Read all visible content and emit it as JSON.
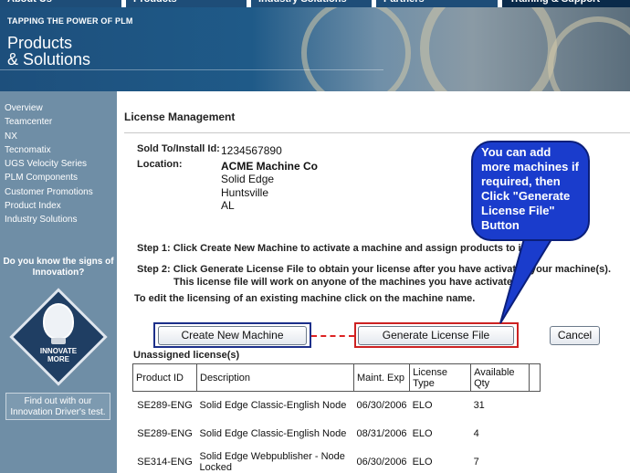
{
  "top_nav": [
    "About Us",
    "Products",
    "Industry Solutions",
    "Partners",
    "Training & Support"
  ],
  "banner": {
    "tagline": "TAPPING THE POWER OF PLM",
    "title_line1": "Products",
    "title_line2": "& Solutions"
  },
  "sidebar": {
    "items": [
      "Overview",
      "Teamcenter",
      "NX",
      "Tecnomatix",
      "UGS Velocity Series",
      "PLM Components",
      "Customer Promotions",
      "Product Index",
      "Industry Solutions"
    ],
    "promo_question": "Do you know the signs of Innovation?",
    "promo_badge_line1": "INNOVATE",
    "promo_badge_line2": "MORE",
    "promo_button": "Find out with our Innovation Driver's test."
  },
  "main": {
    "title": "License Management",
    "sold_to_label": "Sold To/Install Id:",
    "sold_to_value": "1234567890",
    "location_label": "Location:",
    "location_company": "ACME Machine Co",
    "location_line2": "Solid Edge",
    "location_line3": "Huntsville",
    "location_line4": "AL",
    "step1": "Step 1: Click Create New Machine to activate a machine and assign products to it.",
    "step2_line1": "Step 2: Click Generate License File to obtain your license after you have activated your machine(s).",
    "step2_line2": "This license file will work on anyone of the machines you have activated.",
    "edit_note": "To edit the licensing of an existing machine click on the machine name.",
    "create_button": "Create New Machine",
    "generate_button": "Generate License File",
    "cancel_button": "Cancel",
    "unassigned_label": "Unassigned license(s)",
    "table": {
      "headers": [
        "Product ID",
        "Description",
        "Maint. Exp",
        "License Type",
        "Available Qty"
      ],
      "rows": [
        [
          "SE289-ENG",
          "Solid Edge Classic-English Node",
          "06/30/2006",
          "ELO",
          "31"
        ],
        [
          "SE289-ENG",
          "Solid Edge Classic-English Node",
          "08/31/2006",
          "ELO",
          "4"
        ],
        [
          "SE314-ENG",
          "Solid Edge Webpublisher - Node Locked",
          "06/30/2006",
          "ELO",
          "7"
        ]
      ]
    }
  },
  "callout": {
    "text": "You can add more machines if required, then Click \"Generate License File\" Button"
  },
  "colors": {
    "nav_blue": "#1e4d78",
    "sidebar_blue": "#6f8ea6",
    "callout_blue": "#1a3ccc",
    "highlight_red": "#cc2222"
  }
}
